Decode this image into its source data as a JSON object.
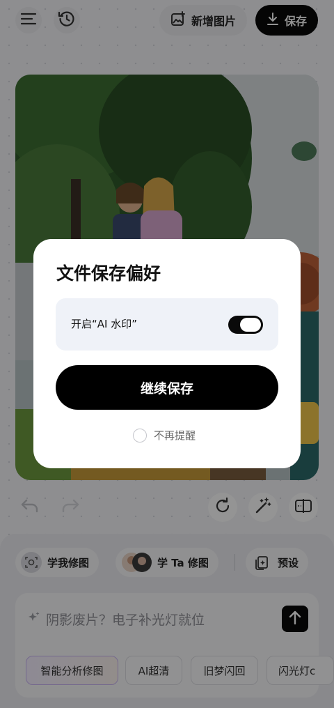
{
  "topbar": {
    "menu_icon": "menu-icon",
    "history_icon": "history-icon",
    "add_image_label": "新增图片",
    "save_label": "保存"
  },
  "photo": {
    "description_icon": "photo"
  },
  "edit_tools": {
    "undo_icon": "undo-icon",
    "redo_icon": "redo-icon",
    "rotate_icon": "rotate-icon",
    "magic_wand_icon": "magic-wand-icon",
    "compare_icon": "compare-icon"
  },
  "style_chips": [
    {
      "label": "学我修图",
      "icon": "face-scan-icon"
    },
    {
      "label": "学 Ta 修图",
      "icon": "avatars-icon"
    },
    {
      "label": "预设",
      "icon": "preset-icon"
    }
  ],
  "prompt": {
    "placeholder": "阴影废片？电子补光灯就位"
  },
  "tags": [
    "智能分析修图",
    "AI超清",
    "旧梦闪回",
    "闪光灯c"
  ],
  "dialog": {
    "title": "文件保存偏好",
    "watermark_label": "开启“AI 水印”",
    "watermark_on": true,
    "continue_label": "继续保存",
    "dont_remind_label": "不再提醒",
    "dont_remind_checked": false
  }
}
